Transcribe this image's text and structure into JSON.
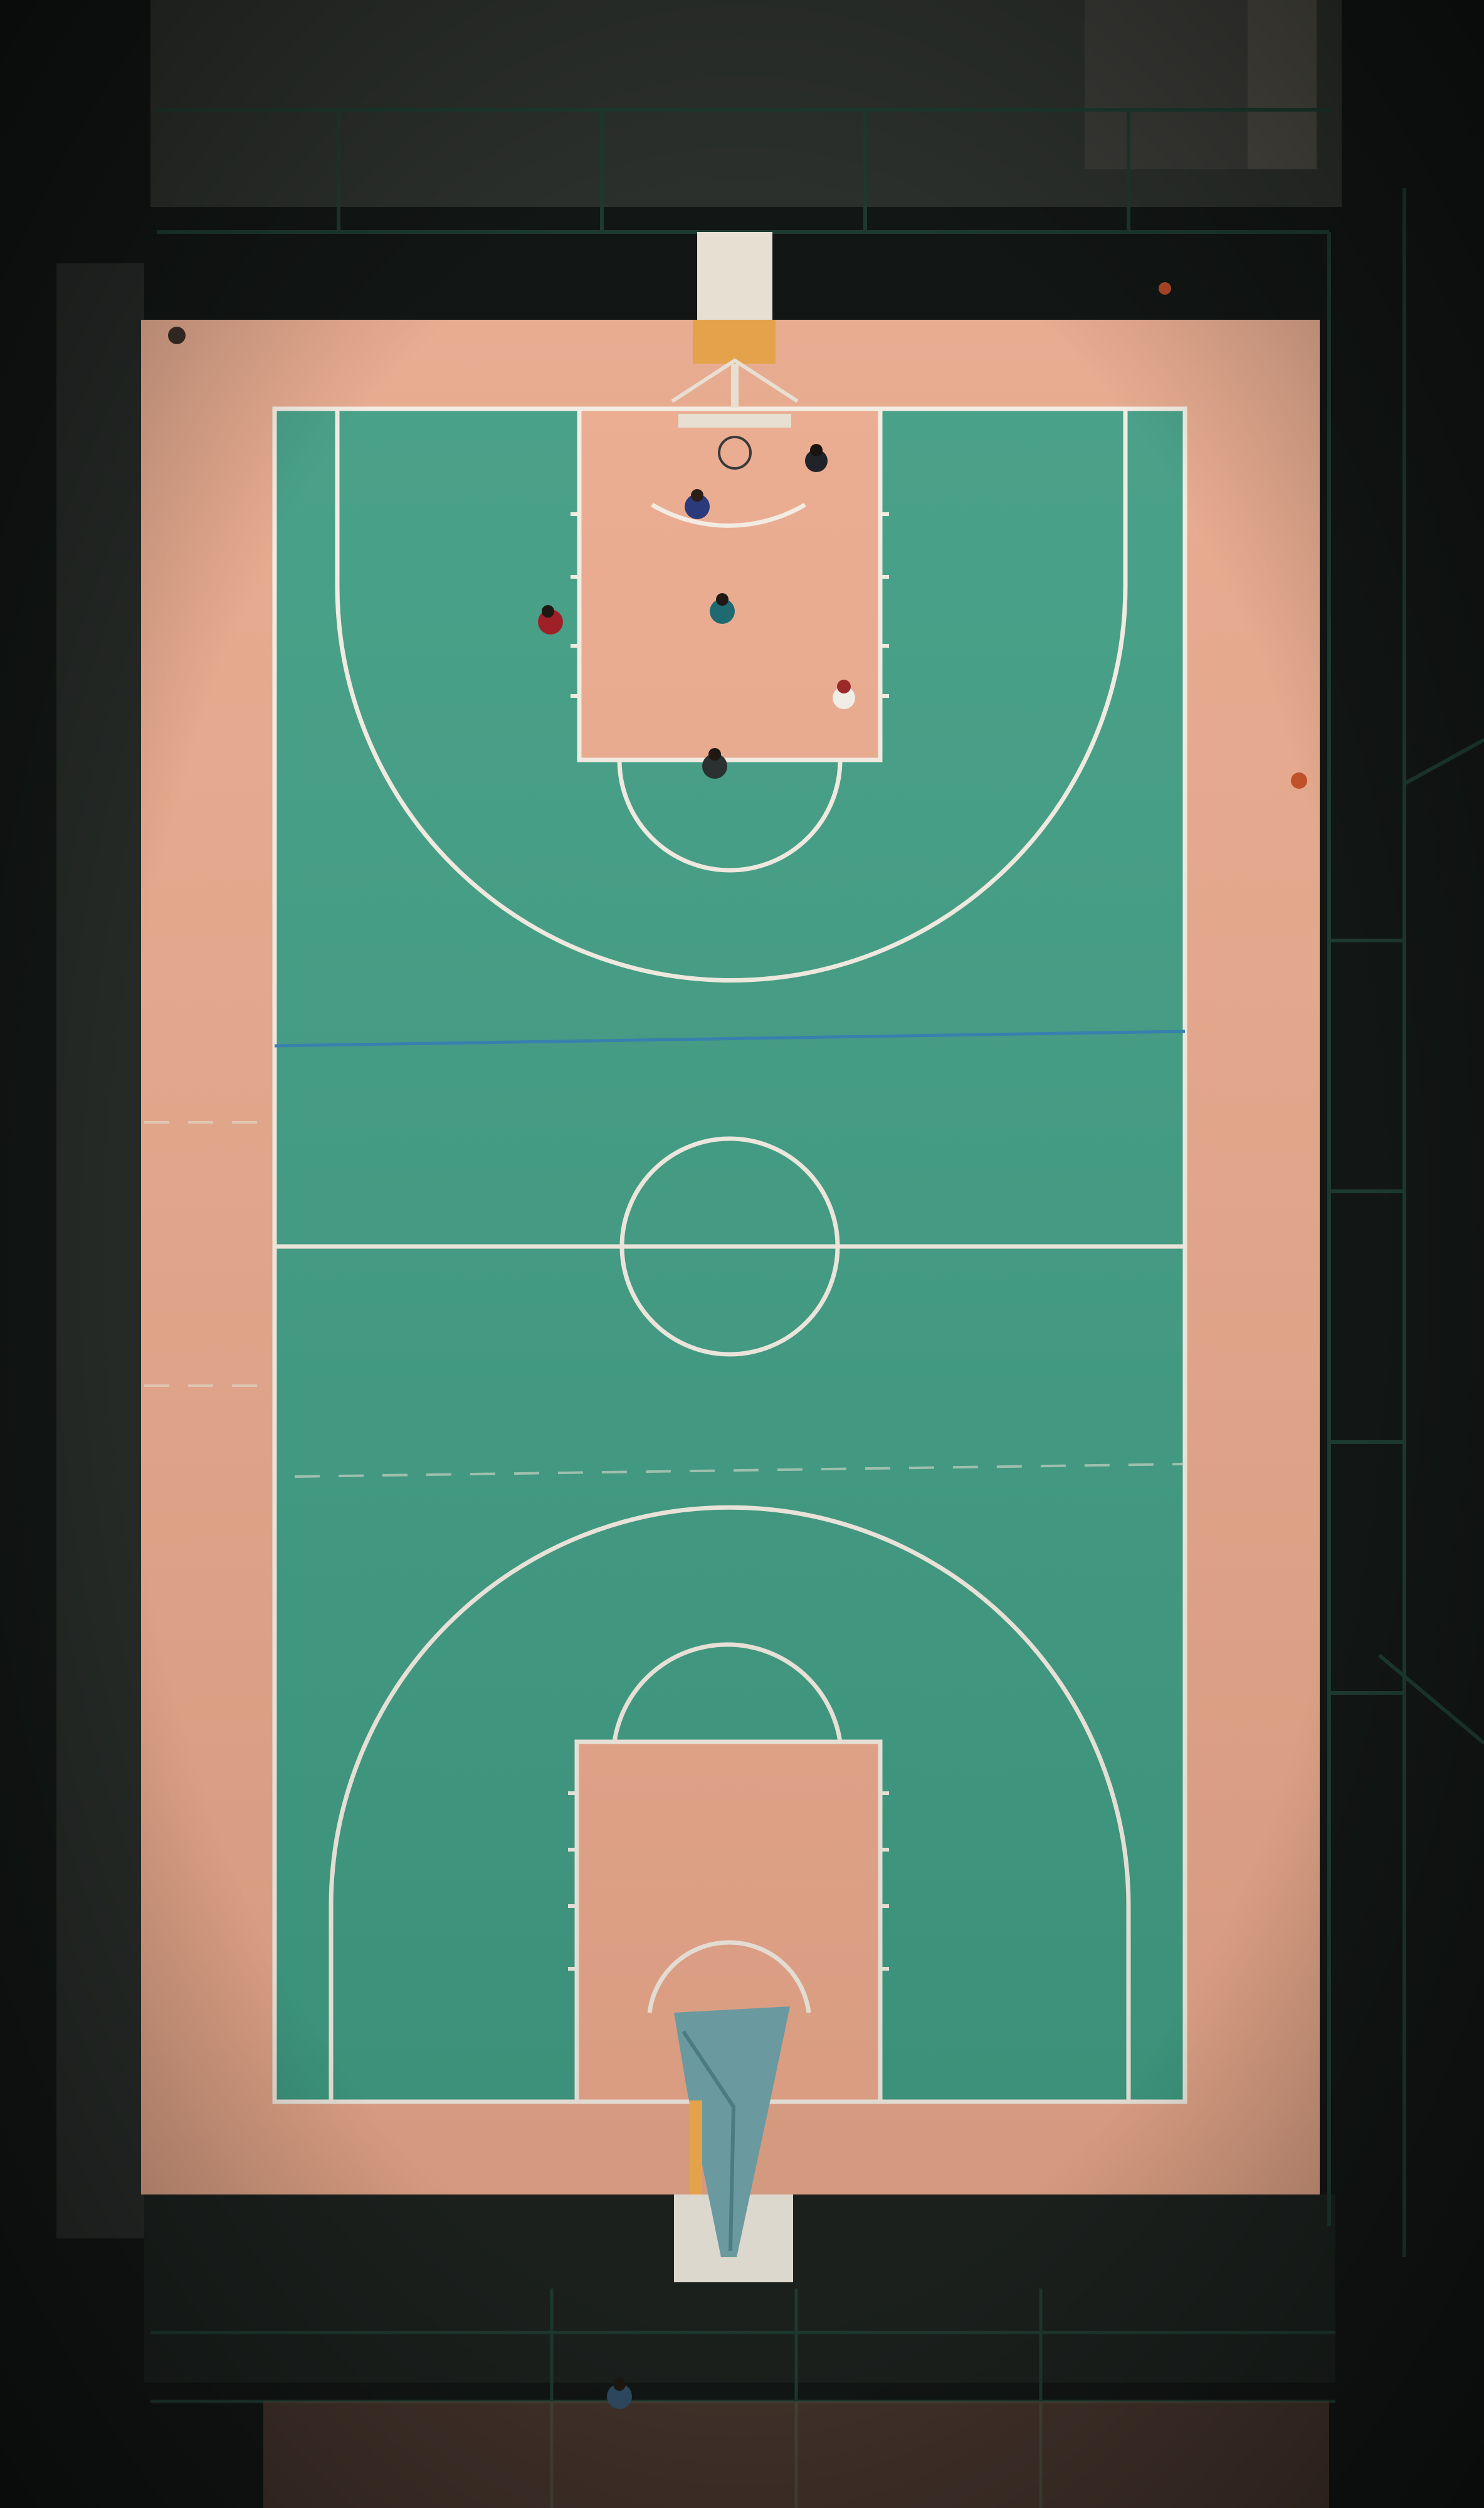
{
  "scene": {
    "subject": "aerial-basketball-court",
    "players_count": 7,
    "colors": {
      "surroundings": "#121614",
      "concrete": "#2c302c",
      "court_border": "#e6a78a",
      "playing_field": "#3f9c82",
      "key_paint": "#eba98c",
      "lines": "#f3ece2",
      "divider_line": "#2f7fb0",
      "fence": "#1d3a30",
      "backboard": "#e7dfd2",
      "tarp": "#6a9aa0"
    }
  }
}
